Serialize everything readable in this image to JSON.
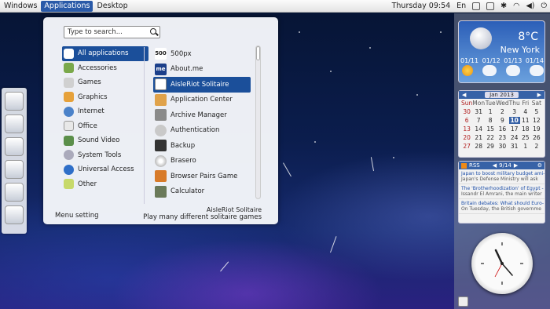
{
  "topbar": {
    "windows": "Windows",
    "applications": "Applications",
    "desktop": "Desktop",
    "clock": "Thursday 09:54",
    "lang": "En"
  },
  "menu": {
    "search_placeholder": "Type to search...",
    "categories": [
      "All applications",
      "Accessories",
      "Games",
      "Graphics",
      "Internet",
      "Office",
      "Sound  Video",
      "System Tools",
      "Universal Access",
      "Other"
    ],
    "apps": [
      "500px",
      "About.me",
      "AisleRiot Solitaire",
      "Application Center",
      "Archive Manager",
      "Authentication",
      "Backup",
      "Brasero",
      "Browser Pairs Game",
      "Calculator"
    ],
    "apps_icon_text": [
      "500",
      "me"
    ],
    "menu_setting": "Menu setting",
    "selected_app_name": "AisleRiot Solitaire",
    "selected_app_desc": "Play many different solitaire games"
  },
  "weather": {
    "temp": "8°C",
    "city": "New York",
    "days": [
      "01/11",
      "01/12",
      "01/13",
      "01/14"
    ]
  },
  "calendar": {
    "month": "Jan 2013",
    "weekdays": [
      "Sun",
      "Mon",
      "Tue",
      "Wed",
      "Thu",
      "Fri",
      "Sat"
    ],
    "rows": [
      [
        "30",
        "31",
        "1",
        "2",
        "3",
        "4",
        "5"
      ],
      [
        "6",
        "7",
        "8",
        "9",
        "10",
        "11",
        "12"
      ],
      [
        "13",
        "14",
        "15",
        "16",
        "17",
        "18",
        "19"
      ],
      [
        "20",
        "21",
        "22",
        "23",
        "24",
        "25",
        "26"
      ],
      [
        "27",
        "28",
        "29",
        "30",
        "31",
        "1",
        "2"
      ]
    ],
    "today": "10"
  },
  "rss": {
    "title": "RSS",
    "page": "9/14",
    "items": [
      {
        "title": "Japan to boost military budget ami-",
        "desc": "Japan's Defense Ministry will ask"
      },
      {
        "title": "The 'Brotherhoodization' of Egypt -",
        "desc": "Issandr El Amrani, the main writer"
      },
      {
        "title": "Britain debates: What should Euro-",
        "desc": "On Tuesday, the British governme"
      }
    ]
  },
  "colors": {
    "accent": "#1b4f9a",
    "menu_bg": "#f4f6fa"
  }
}
